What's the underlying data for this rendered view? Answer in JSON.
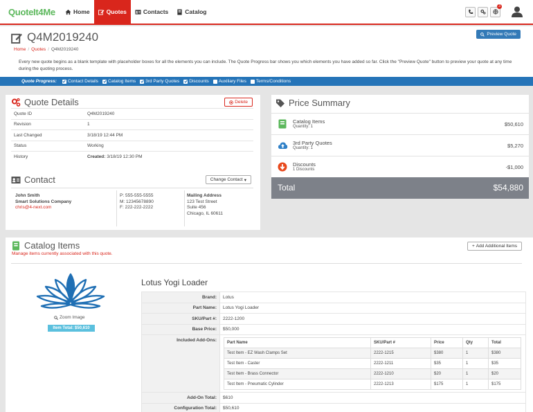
{
  "app": {
    "logo": "QuoteIt4Me"
  },
  "nav": [
    {
      "label": "Home",
      "icon": "home-icon",
      "active": false
    },
    {
      "label": "Quotes",
      "icon": "edit-icon",
      "active": true
    },
    {
      "label": "Contacts",
      "icon": "contact-card-icon",
      "active": false
    },
    {
      "label": "Catalog",
      "icon": "book-icon",
      "active": false
    }
  ],
  "notifications": {
    "count": "3"
  },
  "page": {
    "title": "Q4M2019240",
    "breadcrumb": [
      "Home",
      "Quotes",
      "Q4M2019240"
    ],
    "description": "Every new quote begins as a blank template with placeholder boxes for all the elements you can include. The Quote Progress bar shows you which elements you have added so far. Click the \"Preview Quote\" button to preview your quote at any time during the quoting process.",
    "preview_button": "Preview Quote"
  },
  "progress": {
    "label": "Quote Progress:",
    "steps": [
      {
        "label": "Contact Details",
        "checked": true
      },
      {
        "label": "Catalog Items",
        "checked": true
      },
      {
        "label": "3rd Party Quotes",
        "checked": true
      },
      {
        "label": "Discounts",
        "checked": true
      },
      {
        "label": "Auxiliary Files",
        "checked": false
      },
      {
        "label": "Terms/Conditions",
        "checked": false
      }
    ]
  },
  "quote_details": {
    "title": "Quote Details",
    "delete_button": "Delete",
    "rows": [
      {
        "key": "Quote ID",
        "value": "Q4M2019240"
      },
      {
        "key": "Revision",
        "value": "1"
      },
      {
        "key": "Last Changed",
        "value": "3/18/19 12:44 PM"
      },
      {
        "key": "Status",
        "value": "Working"
      }
    ],
    "history": {
      "key": "History",
      "prefix": "Created:",
      "value": "3/18/19 12:30 PM"
    }
  },
  "contact": {
    "title": "Contact",
    "change_button": "Change Contact",
    "name": "John Smith",
    "company": "Smart Solutions Company",
    "email": "chris@4-next.com",
    "phones": [
      {
        "type": "P:",
        "number": "555-555-5555"
      },
      {
        "type": "M:",
        "number": "12345678890"
      },
      {
        "type": "F:",
        "number": "222-222-2222"
      }
    ],
    "mailing": {
      "label": "Mailing Address",
      "line1": "123 Test Street",
      "line2": "Suite 456",
      "line3": "Chicago, IL 60611"
    }
  },
  "price_summary": {
    "title": "Price Summary",
    "rows": [
      {
        "name": "Catalog Items",
        "sub": "Quantity: 1",
        "amount": "$50,610",
        "color": "#5cb85c"
      },
      {
        "name": "3rd Party Quotes",
        "sub": "Quantity: 1",
        "amount": "$5,270",
        "color": "#2f80c7"
      },
      {
        "name": "Discounts",
        "sub": "1 Discounts",
        "amount": "-$1,000",
        "color": "#e8481c"
      }
    ],
    "total_label": "Total",
    "total_value": "$54,880"
  },
  "catalog": {
    "title": "Catalog Items",
    "subtitle": "Manage items currently associated with this quote.",
    "add_button": "Add Additional Items",
    "zoom_label": "Zoom Image",
    "item_total": "Item Total: $50,610",
    "product": {
      "name": "Lotus Yogi Loader",
      "specs": [
        {
          "key": "Brand:",
          "value": "Lotus"
        },
        {
          "key": "Part Name:",
          "value": "Lotus Yogi Loader"
        },
        {
          "key": "SKU/Part #:",
          "value": "2222-1200"
        },
        {
          "key": "Base Price:",
          "value": "$50,000"
        }
      ],
      "addons_label": "Included Add-Ons:",
      "addons_headers": [
        "Part Name",
        "SKU/Part #",
        "Price",
        "Qty",
        "Total"
      ],
      "addons": [
        [
          "Test Item - EZ Wash Clamps Set",
          "2222-1215",
          "$380",
          "1",
          "$380"
        ],
        [
          "Test Item - Caster",
          "2222-1211",
          "$35",
          "1",
          "$35"
        ],
        [
          "Test Item - Brass Connector",
          "2222-1210",
          "$20",
          "1",
          "$20"
        ],
        [
          "Test Item - Pneumatic Cylinder",
          "2222-1213",
          "$175",
          "1",
          "$175"
        ]
      ],
      "addon_total_label": "Add-On Total:",
      "addon_total": "$610",
      "config_total_label": "Configuration Total:",
      "config_total": "$50,610"
    }
  },
  "colors": {
    "brand_red": "#d9261c",
    "progress_blue": "#2574b8",
    "logo_green": "#5cb85c",
    "total_gray": "#7d8189"
  }
}
